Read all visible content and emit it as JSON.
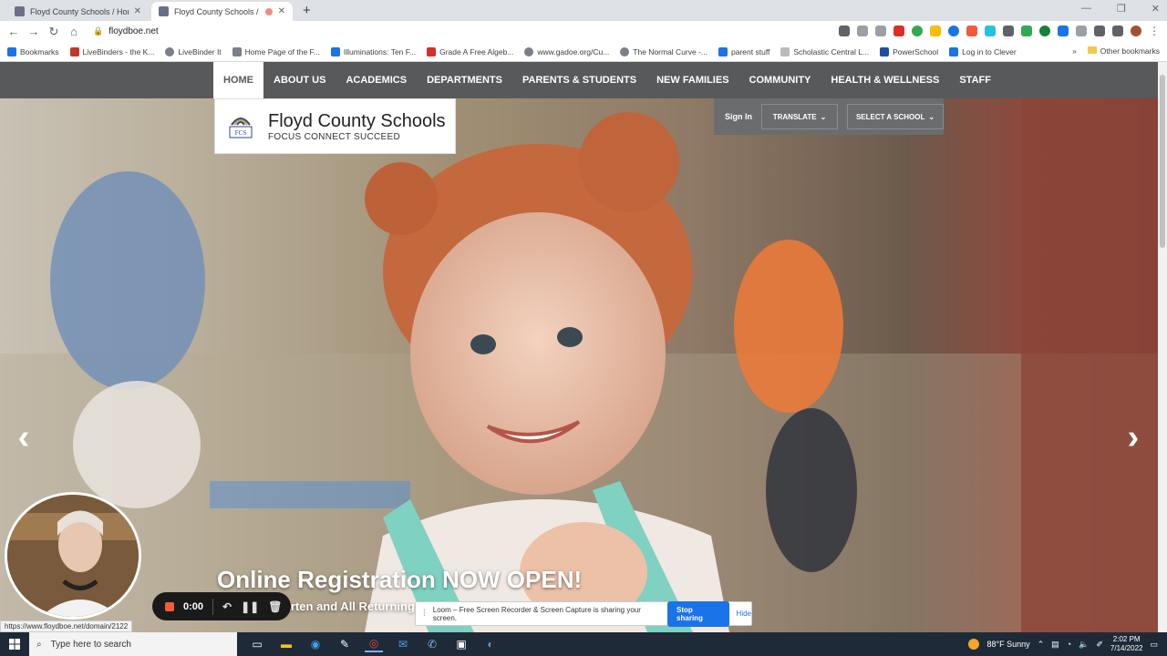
{
  "browser": {
    "tabs": [
      {
        "title": "Floyd County Schools / Homepa",
        "active": false
      },
      {
        "title": "Floyd County Schools / Hom",
        "active": true
      }
    ],
    "url": "floydboe.net",
    "bookmarks": [
      "Bookmarks",
      "LiveBinders - the K...",
      "LiveBinder It",
      "Home Page of the F...",
      "Illuminations: Ten F...",
      "Grade A Free Algeb...",
      "www.gadoe.org/Cu...",
      "The Normal Curve -...",
      "parent stuff",
      "Scholastic Central L...",
      "PowerSchool",
      "Log in to Clever"
    ],
    "other_bookmarks": "Other bookmarks",
    "status_url": "https://www.floydboe.net/domain/2122"
  },
  "site": {
    "nav": [
      "HOME",
      "ABOUT US",
      "ACADEMICS",
      "DEPARTMENTS",
      "PARENTS & STUDENTS",
      "NEW FAMILIES",
      "COMMUNITY",
      "HEALTH & WELLNESS",
      "STAFF"
    ],
    "logo": {
      "mark_text": "FCS",
      "name": "Floyd County Schools",
      "tagline": "FOCUS CONNECT SUCCEED"
    },
    "util": {
      "signin": "Sign In",
      "translate": "TRANSLATE",
      "select_school": "SELECT A SCHOOL"
    },
    "hero": {
      "headline": "Online Registration NOW OPEN!",
      "subline": "For Kindergarten and All Returning Students",
      "prev_glyph": "‹",
      "next_glyph": "›"
    }
  },
  "loom": {
    "timer": "0:00",
    "share_message": "Loom – Free Screen Recorder & Screen Capture is sharing your screen.",
    "stop_label": "Stop sharing",
    "hide_label": "Hide"
  },
  "taskbar": {
    "search_placeholder": "Type here to search",
    "weather": "88°F  Sunny",
    "time": "2:02 PM",
    "date": "7/14/2022"
  },
  "colors": {
    "nav_bg": "#58595b",
    "util_bg": "#6b6c6e",
    "stop_blue": "#1a73e8",
    "taskbar": "#1f2a38"
  }
}
